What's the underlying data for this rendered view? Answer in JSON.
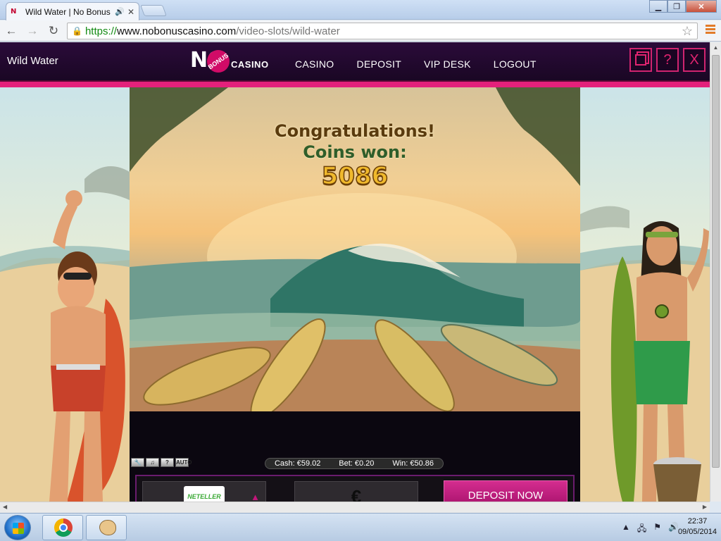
{
  "browser": {
    "tab_title": "Wild Water | No Bonus",
    "favicon_text": "N",
    "url": {
      "scheme": "https://",
      "host": "www.nobonuscasino.com",
      "path": "/video-slots/wild-water"
    }
  },
  "site": {
    "page_title": "Wild Water",
    "logo": {
      "no": "NO",
      "bonus": "BONUS",
      "casino": "CASINO"
    },
    "nav": [
      "CASINO",
      "DEPOSIT",
      "VIP DESK",
      "LOGOUT"
    ],
    "header_buttons": {
      "help": "?",
      "close": "X"
    },
    "accent_color": "#e4217b",
    "header_color": "#2b0b3a"
  },
  "game": {
    "congrats_line1": "Congratulations!",
    "congrats_line2": "Coins won:",
    "coins_won": "5086",
    "status": {
      "cash": "Cash: €59.02",
      "bet": "Bet: €0.20",
      "win": "Win: €50.86"
    },
    "tools": [
      "🔧",
      "♫",
      "?",
      "AUTO"
    ],
    "deposit": {
      "method": "NETELLER",
      "currency": "€",
      "button": "DEPOSIT NOW"
    }
  },
  "taskbar": {
    "time": "22:37",
    "date": "09/05/2014"
  }
}
